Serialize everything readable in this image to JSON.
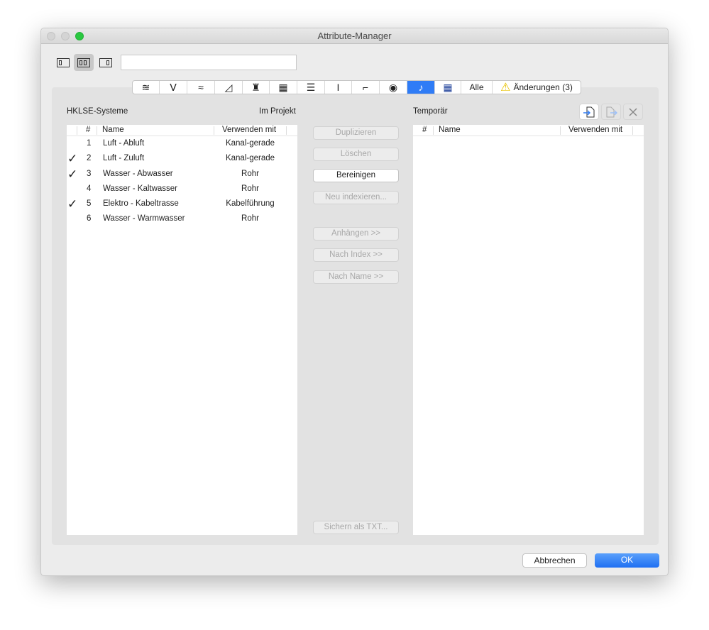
{
  "window": {
    "title": "Attribute-Manager"
  },
  "search": {
    "value": ""
  },
  "tabs": [
    {
      "icon": "layers-icon"
    },
    {
      "icon": "pen-icon"
    },
    {
      "icon": "line-type-icon"
    },
    {
      "icon": "fill-icon"
    },
    {
      "icon": "brush-icon"
    },
    {
      "icon": "building-material-icon"
    },
    {
      "icon": "composite-icon"
    },
    {
      "icon": "profile-icon"
    },
    {
      "icon": "zone-category-icon"
    },
    {
      "icon": "globe-icon"
    },
    {
      "icon": "mep-system-icon"
    },
    {
      "icon": "grid-icon"
    },
    {
      "label": "Alle"
    },
    {
      "label": "Änderungen (3)",
      "icon": "warning-icon"
    }
  ],
  "left": {
    "title": "HKLSE-Systeme",
    "subtitle": "Im Projekt",
    "columns": {
      "num": "#",
      "name": "Name",
      "use": "Verwenden mit"
    },
    "rows": [
      {
        "check": "",
        "num": "1",
        "name": "Luft - Abluft",
        "use": "Kanal-gerade"
      },
      {
        "check": "✓",
        "num": "2",
        "name": "Luft - Zuluft",
        "use": "Kanal-gerade"
      },
      {
        "check": "✓",
        "num": "3",
        "name": "Wasser - Abwasser",
        "use": "Rohr"
      },
      {
        "check": "",
        "num": "4",
        "name": "Wasser - Kaltwasser",
        "use": "Rohr"
      },
      {
        "check": "✓",
        "num": "5",
        "name": "Elektro - Kabeltrasse",
        "use": "Kabelführung"
      },
      {
        "check": "",
        "num": "6",
        "name": "Wasser - Warmwasser",
        "use": "Rohr"
      }
    ]
  },
  "middle": {
    "duplicate": "Duplizieren",
    "delete": "Löschen",
    "purge": "Bereinigen",
    "reindex": "Neu indexieren...",
    "append": "Anhängen >>",
    "by_index": "Nach Index >>",
    "by_name": "Nach Name >>",
    "save_txt": "Sichern als TXT..."
  },
  "right": {
    "title": "Temporär",
    "columns": {
      "num": "#",
      "name": "Name",
      "use": "Verwenden mit"
    }
  },
  "footer": {
    "cancel": "Abbrechen",
    "ok": "OK"
  },
  "colors": {
    "accent": "#2f7cf6",
    "close_green": "#2ac840"
  }
}
